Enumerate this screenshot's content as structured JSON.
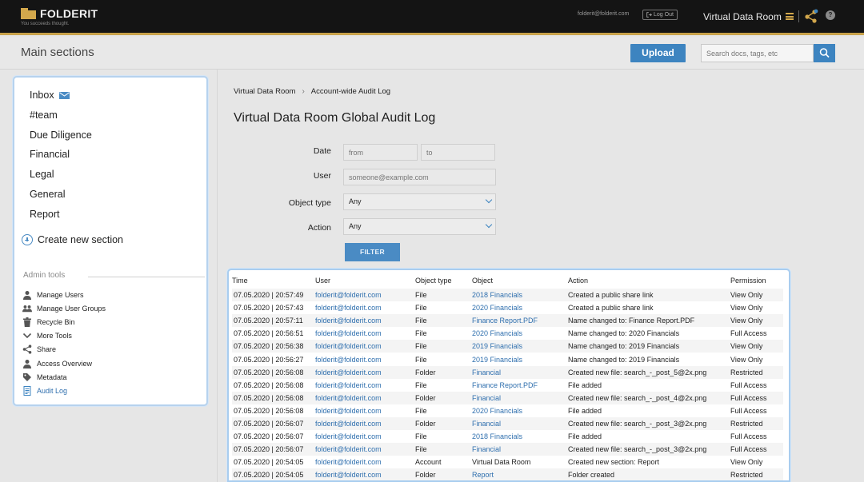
{
  "app": {
    "logo_text": "FOLDERIT",
    "tagline": "You succeeds thought.",
    "user_email": "folderit@folderit.com",
    "logout_label": "Log Out",
    "workspace_title": "Virtual Data Room"
  },
  "subheader": {
    "title": "Main sections",
    "upload_label": "Upload",
    "search_placeholder": "Search docs, tags, etc"
  },
  "sidebar": {
    "sections": [
      {
        "label": "Inbox",
        "icon": "envelope-icon"
      },
      {
        "label": "#team"
      },
      {
        "label": "Due Diligence"
      },
      {
        "label": "Financial"
      },
      {
        "label": "Legal"
      },
      {
        "label": "General"
      },
      {
        "label": "Report"
      }
    ],
    "create_label": "Create new section",
    "admin_label": "Admin tools",
    "admin_items": [
      {
        "label": "Manage Users",
        "icon": "user-icon"
      },
      {
        "label": "Manage User Groups",
        "icon": "users-icon"
      },
      {
        "label": "Recycle Bin",
        "icon": "trash-icon"
      },
      {
        "label": "More Tools",
        "icon": "chevron-down-icon"
      },
      {
        "label": "Share",
        "icon": "share-icon"
      },
      {
        "label": "Access Overview",
        "icon": "user-icon"
      },
      {
        "label": "Metadata",
        "icon": "tag-icon"
      },
      {
        "label": "Audit Log",
        "icon": "document-icon",
        "active": true
      }
    ]
  },
  "breadcrumb": [
    "Virtual Data Room",
    "Account-wide Audit Log"
  ],
  "page_title": "Virtual Data Room Global Audit Log",
  "filters": {
    "date_label": "Date",
    "date_from_placeholder": "from",
    "date_to_placeholder": "to",
    "user_label": "User",
    "user_placeholder": "someone@example.com",
    "object_type_label": "Object type",
    "object_type_value": "Any",
    "action_label": "Action",
    "action_value": "Any",
    "filter_label": "FILTER"
  },
  "table": {
    "columns": [
      "Time",
      "User",
      "Object type",
      "Object",
      "Action",
      "Permission"
    ],
    "rows": [
      [
        "07.05.2020 | 20:57:49",
        "folderit@folderit.com",
        "File",
        "2018 Financials",
        "Created a public share link",
        "View Only"
      ],
      [
        "07.05.2020 | 20:57:43",
        "folderit@folderit.com",
        "File",
        "2020 Financials",
        "Created a public share link",
        "View Only"
      ],
      [
        "07.05.2020 | 20:57:11",
        "folderit@folderit.com",
        "File",
        "Finance Report.PDF",
        "Name changed to: Finance Report.PDF",
        "View Only"
      ],
      [
        "07.05.2020 | 20:56:51",
        "folderit@folderit.com",
        "File",
        "2020 Financials",
        "Name changed to: 2020 Financials",
        "Full Access"
      ],
      [
        "07.05.2020 | 20:56:38",
        "folderit@folderit.com",
        "File",
        "2019 Financials",
        "Name changed to: 2019 Financials",
        "View Only"
      ],
      [
        "07.05.2020 | 20:56:27",
        "folderit@folderit.com",
        "File",
        "2019 Financials",
        "Name changed to: 2019 Financials",
        "View Only"
      ],
      [
        "07.05.2020 | 20:56:08",
        "folderit@folderit.com",
        "Folder",
        "Financial",
        "Created new file: search_-_post_5@2x.png",
        "Restricted"
      ],
      [
        "07.05.2020 | 20:56:08",
        "folderit@folderit.com",
        "File",
        "Finance Report.PDF",
        "File added",
        "Full Access"
      ],
      [
        "07.05.2020 | 20:56:08",
        "folderit@folderit.com",
        "Folder",
        "Financial",
        "Created new file: search_-_post_4@2x.png",
        "Full Access"
      ],
      [
        "07.05.2020 | 20:56:08",
        "folderit@folderit.com",
        "File",
        "2020 Financials",
        "File added",
        "Full Access"
      ],
      [
        "07.05.2020 | 20:56:07",
        "folderit@folderit.com",
        "Folder",
        "Financial",
        "Created new file: search_-_post_3@2x.png",
        "Restricted"
      ],
      [
        "07.05.2020 | 20:56:07",
        "folderit@folderit.com",
        "File",
        "2018 Financials",
        "File added",
        "Full Access"
      ],
      [
        "07.05.2020 | 20:56:07",
        "folderit@folderit.com",
        "File",
        "Financial",
        "Created new file: search_-_post_3@2x.png",
        "Full Access"
      ],
      [
        "07.05.2020 | 20:54:05",
        "folderit@folderit.com",
        "Account",
        "Virtual Data Room",
        "Created new section: Report",
        "View Only"
      ],
      [
        "07.05.2020 | 20:54:05",
        "folderit@folderit.com",
        "Folder",
        "Report",
        "Folder created",
        "Restricted"
      ]
    ]
  },
  "colors": {
    "accent": "#3d84c0",
    "brand_gold": "#d3a84c",
    "link": "#2f6fae"
  }
}
